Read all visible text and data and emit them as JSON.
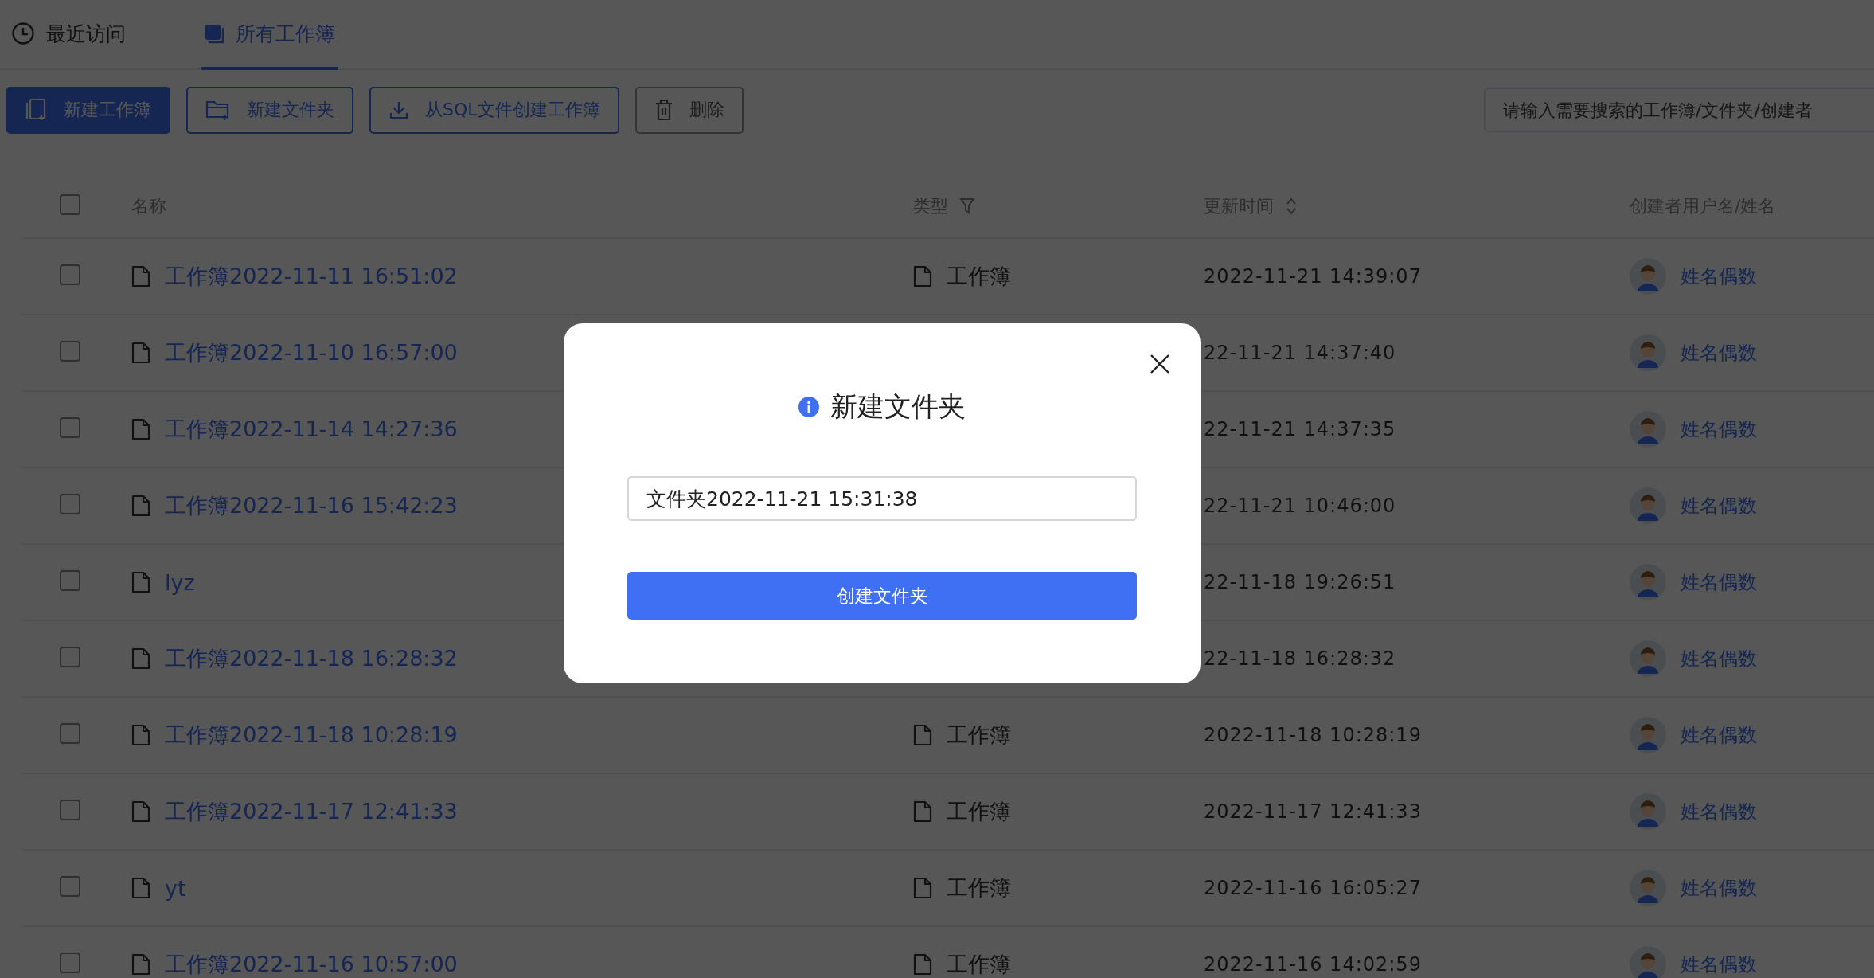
{
  "tabs": [
    {
      "label": "最近访问",
      "selected": false
    },
    {
      "label": "所有工作簿",
      "selected": true
    }
  ],
  "toolbar": {
    "buttons": [
      {
        "label": "新建工作簿",
        "kind": "primary"
      },
      {
        "label": "新建文件夹",
        "kind": "outline"
      },
      {
        "label": "从SQL文件创建工作簿",
        "kind": "outline"
      },
      {
        "label": "删除",
        "kind": "disabled"
      }
    ],
    "search": {
      "placeholder": "请输入需要搜索的工作簿/文件夹/创建者"
    }
  },
  "table": {
    "select_all": {
      "checked": false
    },
    "columns": [
      {
        "label": "名称"
      },
      {
        "label": "类型"
      },
      {
        "label": "更新时间"
      },
      {
        "label": "创建者用户名/姓名"
      }
    ],
    "rows": [
      {
        "checked": false,
        "name": "工作簿2022-11-11 16:51:02",
        "type": "工作簿",
        "updated": "2022-11-21 14:39:07",
        "creator": "姓名偶数"
      },
      {
        "checked": false,
        "name": "工作簿2022-11-10 16:57:00",
        "updated": "22-11-21 14:37:40",
        "creator": "姓名偶数"
      },
      {
        "checked": false,
        "name": "工作簿2022-11-14 14:27:36",
        "updated": "22-11-21 14:37:35",
        "creator": "姓名偶数"
      },
      {
        "checked": false,
        "name": "工作簿2022-11-16 15:42:23",
        "updated": "22-11-21 10:46:00",
        "creator": "姓名偶数"
      },
      {
        "checked": false,
        "name": "lyz",
        "updated": "22-11-18 19:26:51",
        "creator": "姓名偶数"
      },
      {
        "checked": false,
        "name": "工作簿2022-11-18 16:28:32",
        "updated": "22-11-18 16:28:32",
        "creator": "姓名偶数"
      },
      {
        "checked": false,
        "name": "工作簿2022-11-18 10:28:19",
        "type": "工作簿",
        "updated": "2022-11-18 10:28:19",
        "creator": "姓名偶数"
      },
      {
        "checked": false,
        "name": "工作簿2022-11-17 12:41:33",
        "type": "工作簿",
        "updated": "2022-11-17 12:41:33",
        "creator": "姓名偶数"
      },
      {
        "checked": false,
        "name": "yt",
        "type": "工作簿",
        "updated": "2022-11-16 16:05:27",
        "creator": "姓名偶数"
      },
      {
        "checked": false,
        "name": "工作簿2022-11-16 10:57:00",
        "type": "工作簿",
        "updated": "2022-11-16 14:02:59",
        "creator": "姓名偶数"
      }
    ]
  },
  "dialog": {
    "title": "新建文件夹",
    "value": "文件夹2022-11-21 15:31:38",
    "button": "创建文件夹"
  }
}
